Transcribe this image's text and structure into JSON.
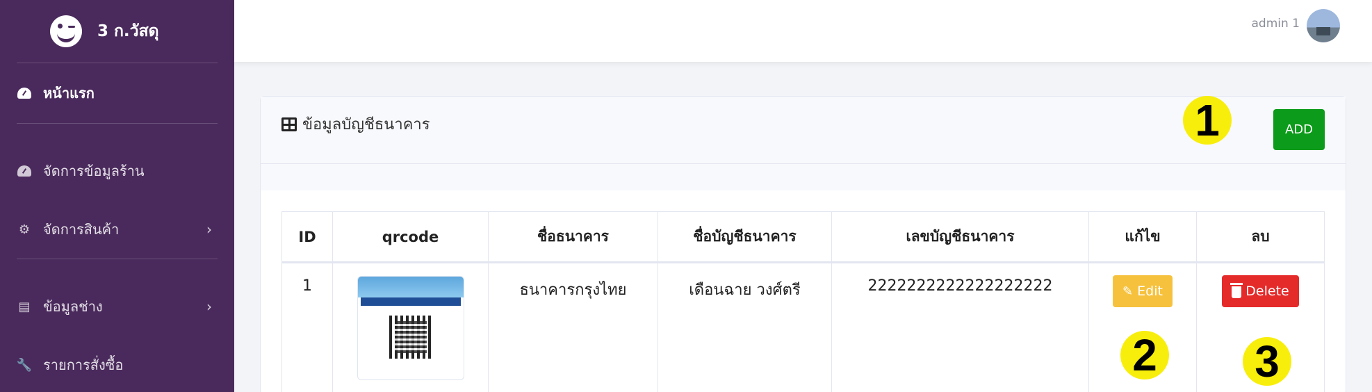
{
  "sidebar": {
    "brand_title": "3 ก.วัสดุ",
    "items": [
      {
        "label": "หน้าแรก",
        "icon": "gauge-icon"
      },
      {
        "label": "จัดการข้อมูลร้าน",
        "icon": "gauge-icon"
      },
      {
        "label": "จัดการสินค้า",
        "icon": "gear-icon"
      },
      {
        "label": "ข้อมูลช่าง",
        "icon": "list-icon"
      },
      {
        "label": "รายการสั่งซื้อ",
        "icon": "wrench-icon"
      }
    ]
  },
  "topbar": {
    "user_name": "admin 1"
  },
  "card": {
    "title": "ข้อมูลบัญชีธนาคาร",
    "add_label": "ADD"
  },
  "table": {
    "headers": [
      "ID",
      "qrcode",
      "ชื่อธนาคาร",
      "ชื่อบัญชีธนาคาร",
      "เลขบัญชีธนาคาร",
      "แก้ไข",
      "ลบ"
    ],
    "rows": [
      {
        "id": "1",
        "bank_name": "ธนาคารกรุงไทย",
        "account_name": "เดือนฉาย วงศ์ตรี",
        "account_number": "2222222222222222222"
      }
    ],
    "edit_label": "Edit",
    "delete_label": "Delete"
  },
  "markers": [
    "1",
    "2",
    "3"
  ],
  "colors": {
    "sidebar": "#4a2a5c",
    "add_button": "#0c9b1a",
    "edit_button": "#f6c23e",
    "delete_button": "#e52a2a",
    "marker": "#f8ee0c"
  }
}
